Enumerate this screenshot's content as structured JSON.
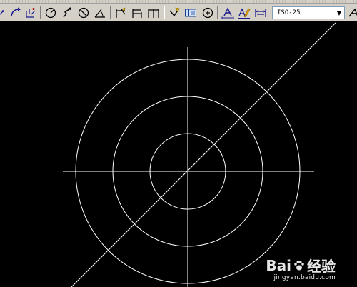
{
  "toolbar": {
    "icons": [
      "dim-linear-partial-icon",
      "dim-arc-length-icon",
      "dim-ordinate-icon",
      "dim-radius-icon",
      "dim-jogged-icon",
      "dim-diameter-icon",
      "dim-angular-icon",
      "quick-dimension-icon",
      "dim-baseline-icon",
      "dim-continue-icon",
      "quick-leader-icon",
      "tolerance-icon",
      "center-mark-icon",
      "dimension-edit-icon",
      "dimension-text-edit-icon",
      "dimension-update-icon",
      "dim-style-manager-icon"
    ],
    "dimstyle": {
      "value": "ISO-25"
    }
  },
  "canvas": {
    "background": "#000000",
    "stroke": "#ffffff"
  },
  "watermark": {
    "brand": "Bai",
    "brand_cn": "经验",
    "url": "jingyan.baidu.com"
  }
}
